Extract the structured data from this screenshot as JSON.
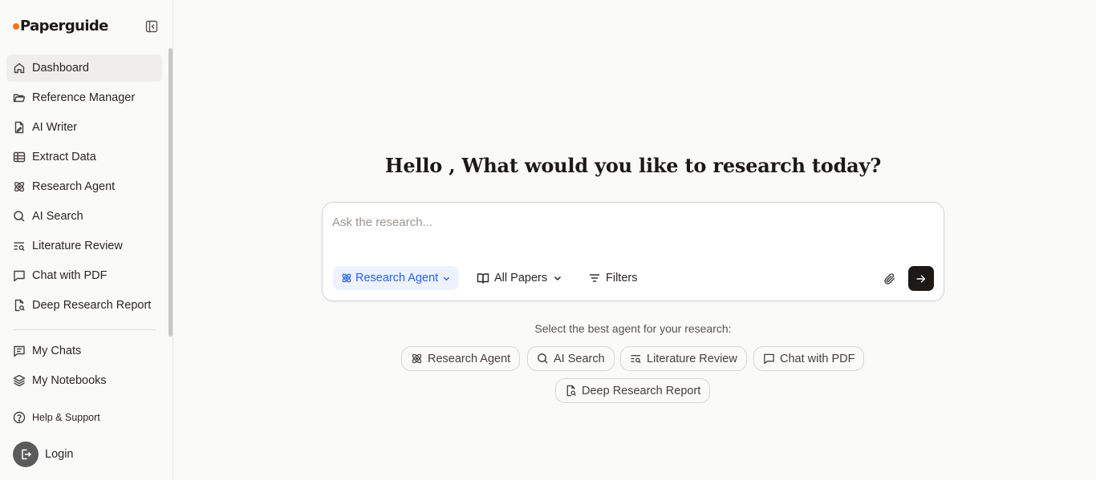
{
  "brand": {
    "name": "Paperguide",
    "accent": "#f97316"
  },
  "sidebar": {
    "items": [
      {
        "label": "Dashboard",
        "icon": "home-icon"
      },
      {
        "label": "Reference Manager",
        "icon": "folder-icon"
      },
      {
        "label": "AI Writer",
        "icon": "document-pen-icon"
      },
      {
        "label": "Extract Data",
        "icon": "table-icon"
      },
      {
        "label": "Research Agent",
        "icon": "atom-icon"
      },
      {
        "label": "AI Search",
        "icon": "search-icon"
      },
      {
        "label": "Literature Review",
        "icon": "list-search-icon"
      },
      {
        "label": "Chat with PDF",
        "icon": "chat-bubble-icon"
      },
      {
        "label": "Deep Research Report",
        "icon": "document-search-icon"
      }
    ],
    "secondary": [
      {
        "label": "My Chats",
        "icon": "chat-lines-icon"
      },
      {
        "label": "My Notebooks",
        "icon": "layers-icon"
      }
    ],
    "help": "Help & Support",
    "login": "Login"
  },
  "main": {
    "greeting": "Hello , What would you like to research today?",
    "prompt_placeholder": "Ask the research...",
    "agent_selector": "Research Agent",
    "papers_selector": "All Papers",
    "filters": "Filters",
    "suggest_caption": "Select the best agent for your research:",
    "agents": [
      {
        "label": "Research Agent",
        "icon": "atom-icon"
      },
      {
        "label": "AI Search",
        "icon": "search-icon"
      },
      {
        "label": "Literature Review",
        "icon": "list-search-icon"
      },
      {
        "label": "Chat with PDF",
        "icon": "chat-bubble-icon"
      },
      {
        "label": "Deep Research Report",
        "icon": "document-search-icon"
      }
    ]
  }
}
